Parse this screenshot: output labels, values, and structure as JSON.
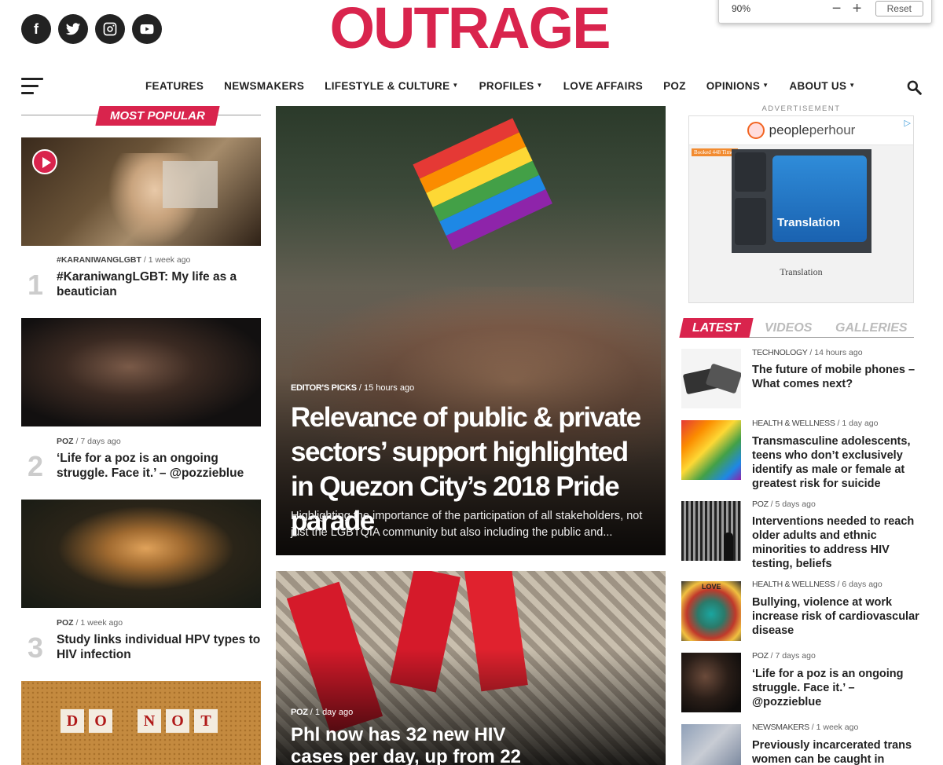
{
  "zoom_bar": {
    "level": "90%",
    "minus": "−",
    "plus": "+",
    "reset_label": "Reset"
  },
  "brand": {
    "logo_text": "OUTRAGE",
    "accent_color": "#d9244d"
  },
  "social": [
    {
      "icon": "facebook-icon",
      "glyph": "f"
    },
    {
      "icon": "twitter-icon"
    },
    {
      "icon": "instagram-icon"
    },
    {
      "icon": "youtube-icon"
    }
  ],
  "nav": {
    "items": [
      {
        "label": "FEATURES"
      },
      {
        "label": "NEWSMAKERS"
      },
      {
        "label": "LIFESTYLE & CULTURE",
        "dropdown": true
      },
      {
        "label": "PROFILES",
        "dropdown": true
      },
      {
        "label": "LOVE AFFAIRS"
      },
      {
        "label": "POZ"
      },
      {
        "label": "OPINIONS",
        "dropdown": true
      },
      {
        "label": "ABOUT US",
        "dropdown": true
      }
    ]
  },
  "most_popular": {
    "heading": "MOST POPULAR",
    "items": [
      {
        "rank": "1",
        "category": "#KARANIWANGLGBT",
        "time": "1 week ago",
        "title": "#KaraniwangLGBT: My life as a beautician"
      },
      {
        "rank": "2",
        "category": "POZ",
        "time": "7 days ago",
        "title": "‘Life for a poz is an ongoing struggle. Face it.’ – @pozzieblue"
      },
      {
        "rank": "3",
        "category": "POZ",
        "time": "1 week ago",
        "title": "Study links individual HPV types to HIV infection"
      },
      {
        "image_text": [
          "D",
          "O",
          "N",
          "O",
          "T"
        ]
      }
    ]
  },
  "features": [
    {
      "category": "EDITOR'S PICKS",
      "time": "15 hours ago",
      "title": "Relevance of public & private sectors’ support highlighted in Quezon City’s 2018 Pride parade",
      "excerpt": "Highlighting the importance of the participation of all stakeholders, not just the LGBTQIA community but also including the public and..."
    },
    {
      "category": "POZ",
      "time": "1 day ago",
      "title": "Phl now has 32 new HIV cases per day, up from 22"
    }
  ],
  "ad": {
    "label": "ADVERTISEMENT",
    "brand_left": "people",
    "brand_right": "perhour",
    "booked": "Booked 448 Times",
    "key_text": "Translation",
    "caption": "Translation"
  },
  "latest": {
    "tabs": [
      "LATEST",
      "VIDEOS",
      "GALLERIES"
    ],
    "items": [
      {
        "category": "TECHNOLOGY",
        "time": "14 hours ago",
        "title": "The future of mobile phones – What comes next?"
      },
      {
        "category": "HEALTH & WELLNESS",
        "time": "1 day ago",
        "title": "Transmasculine adolescents, teens who don’t exclusively identify as male or female at greatest risk for suicide"
      },
      {
        "category": "POZ",
        "time": "5 days ago",
        "title": "Interventions needed to reach older adults and ethnic minorities to address HIV testing, beliefs"
      },
      {
        "category": "HEALTH & WELLNESS",
        "time": "6 days ago",
        "title": "Bullying, violence at work increase risk of cardiovascular disease",
        "image_text": "LOVE"
      },
      {
        "category": "POZ",
        "time": "7 days ago",
        "title": "‘Life for a poz is an ongoing struggle. Face it.’ – @pozzieblue"
      },
      {
        "category": "NEWSMAKERS",
        "time": "1 week ago",
        "title": "Previously incarcerated trans women can be caught in"
      }
    ]
  }
}
